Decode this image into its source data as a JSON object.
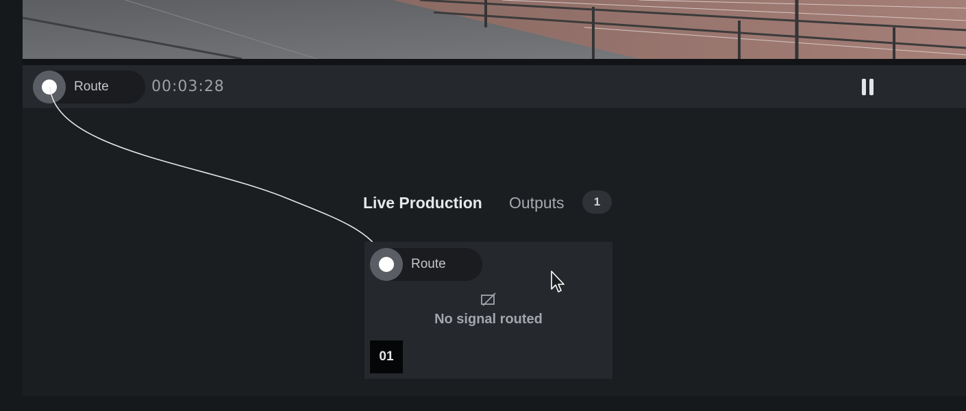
{
  "player": {
    "route_label": "Route",
    "timecode": "00:03:28",
    "pause_icon": "pause-icon"
  },
  "tabs": {
    "live_production": "Live Production",
    "outputs": "Outputs",
    "outputs_count": "1"
  },
  "output_card": {
    "route_label": "Route",
    "status_icon": "no-signal-icon",
    "status_text": "No signal routed",
    "index": "01"
  },
  "colors": {
    "background": "#1b1e21",
    "panel": "#25282c",
    "cable": "#e8e8e8"
  }
}
